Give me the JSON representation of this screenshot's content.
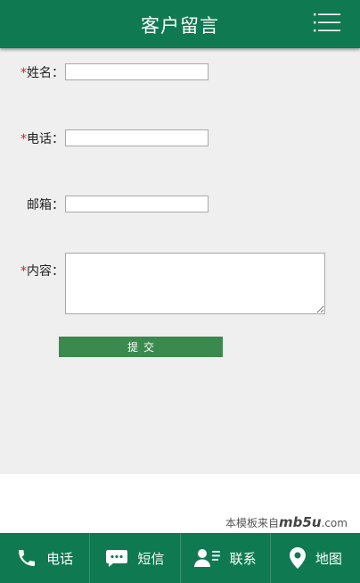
{
  "header": {
    "title": "客户留言",
    "menu_icon": "menu-icon"
  },
  "form": {
    "name": {
      "required_mark": "*",
      "label": "姓名：",
      "value": ""
    },
    "phone": {
      "required_mark": "*",
      "label": "电话：",
      "value": ""
    },
    "email": {
      "required_mark": "",
      "label": "邮箱：",
      "value": ""
    },
    "message": {
      "required_mark": "*",
      "label": "内容：",
      "value": ""
    },
    "submit_label": "提交"
  },
  "watermark": {
    "prefix": "本模板来自",
    "brand": "mb5u",
    "suffix": ".com"
  },
  "footer": {
    "tabs": [
      {
        "label": "电话",
        "icon": "phone-icon"
      },
      {
        "label": "短信",
        "icon": "message-icon"
      },
      {
        "label": "联系",
        "icon": "contact-icon"
      },
      {
        "label": "地图",
        "icon": "map-pin-icon"
      }
    ]
  },
  "colors": {
    "primary": "#0f7a52",
    "button": "#3a8a4e",
    "required": "#cc1f1f",
    "background": "#efefef"
  }
}
